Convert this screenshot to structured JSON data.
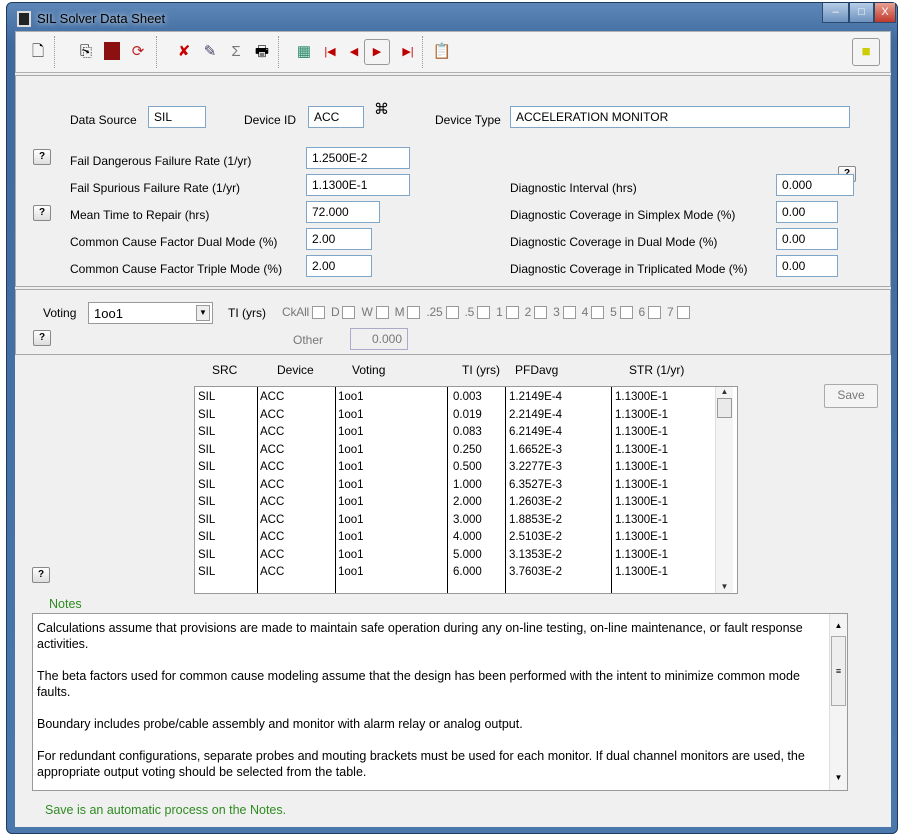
{
  "window": {
    "title": "SIL Solver Data Sheet",
    "minimize": "–",
    "maximize": "□",
    "close": "X"
  },
  "toolbar": {
    "icons": [
      "new-icon",
      "copy-icon",
      "report-icon",
      "refresh-icon",
      "delete-record-icon",
      "edit-record-icon",
      "sum-icon",
      "print-icon",
      "find-icon",
      "first-record-icon",
      "previous-record-icon",
      "next-record-icon",
      "last-record-icon",
      "sil-chart-icon",
      "exit-icon"
    ]
  },
  "device": {
    "data_source_label": "Data Source",
    "data_source": "SIL",
    "device_id_label": "Device ID",
    "device_id": "ACC",
    "device_type_label": "Device Type",
    "device_type": "ACCELERATION MONITOR"
  },
  "rates": {
    "fail_dangerous_label": "Fail Dangerous Failure Rate (1/yr)",
    "fail_dangerous": "1.2500E-2",
    "fail_spurious_label": "Fail Spurious Failure Rate (1/yr)",
    "fail_spurious": "1.1300E-1",
    "mttr_label": "Mean Time to Repair (hrs)",
    "mttr": "72.000",
    "ccf_dual_label": "Common Cause Factor Dual Mode (%)",
    "ccf_dual": "2.00",
    "ccf_triple_label": "Common Cause Factor Triple Mode (%)",
    "ccf_triple": "2.00",
    "diag_interval_label": "Diagnostic Interval (hrs)",
    "diag_interval": "0.000",
    "dc_simplex_label": "Diagnostic Coverage in Simplex Mode (%)",
    "dc_simplex": "0.00",
    "dc_dual_label": "Diagnostic Coverage in Dual Mode (%)",
    "dc_dual": "0.00",
    "dc_triple_label": "Diagnostic Coverage in Triplicated Mode (%)",
    "dc_triple": "0.00"
  },
  "help_label": "?",
  "voting": {
    "label": "Voting",
    "value": "1oo1",
    "ti_label": "TI (yrs)",
    "checkboxes": [
      "CkAll",
      "D",
      "W",
      "M",
      ".25",
      ".5",
      "1",
      "2",
      "3",
      "4",
      "5",
      "6",
      "7"
    ],
    "other_label": "Other",
    "other_value": "0.000"
  },
  "table": {
    "headers": [
      "SRC",
      "Device",
      "Voting",
      "TI (yrs)",
      "PFDavg",
      "STR (1/yr)"
    ],
    "rows": [
      [
        "SIL",
        "ACC",
        "1oo1",
        "0.003",
        "1.2149E-4",
        "1.1300E-1"
      ],
      [
        "SIL",
        "ACC",
        "1oo1",
        "0.019",
        "2.2149E-4",
        "1.1300E-1"
      ],
      [
        "SIL",
        "ACC",
        "1oo1",
        "0.083",
        "6.2149E-4",
        "1.1300E-1"
      ],
      [
        "SIL",
        "ACC",
        "1oo1",
        "0.250",
        "1.6652E-3",
        "1.1300E-1"
      ],
      [
        "SIL",
        "ACC",
        "1oo1",
        "0.500",
        "3.2277E-3",
        "1.1300E-1"
      ],
      [
        "SIL",
        "ACC",
        "1oo1",
        "1.000",
        "6.3527E-3",
        "1.1300E-1"
      ],
      [
        "SIL",
        "ACC",
        "1oo1",
        "2.000",
        "1.2603E-2",
        "1.1300E-1"
      ],
      [
        "SIL",
        "ACC",
        "1oo1",
        "3.000",
        "1.8853E-2",
        "1.1300E-1"
      ],
      [
        "SIL",
        "ACC",
        "1oo1",
        "4.000",
        "2.5103E-2",
        "1.1300E-1"
      ],
      [
        "SIL",
        "ACC",
        "1oo1",
        "5.000",
        "3.1353E-2",
        "1.1300E-1"
      ],
      [
        "SIL",
        "ACC",
        "1oo1",
        "6.000",
        "3.7603E-2",
        "1.1300E-1"
      ]
    ],
    "save_label": "Save"
  },
  "notes": {
    "label": "Notes",
    "paragraphs": [
      "Calculations assume that provisions are made to maintain safe operation during any on-line testing, on-line maintenance, or fault response activities.",
      "The beta factors used for common cause modeling assume that the design has been performed with the intent to minimize common mode faults.",
      "Boundary includes probe/cable assembly and monitor with alarm relay or analog output.",
      "For redundant configurations, separate probes and mouting brackets must be used for each monitor. If dual channel monitors are used, the appropriate output voting should be selected from the table."
    ],
    "status": "Save is an automatic process on the Notes."
  },
  "colors": {
    "notes_green": "#2e8b20",
    "title_bar": "#4a78ad"
  }
}
